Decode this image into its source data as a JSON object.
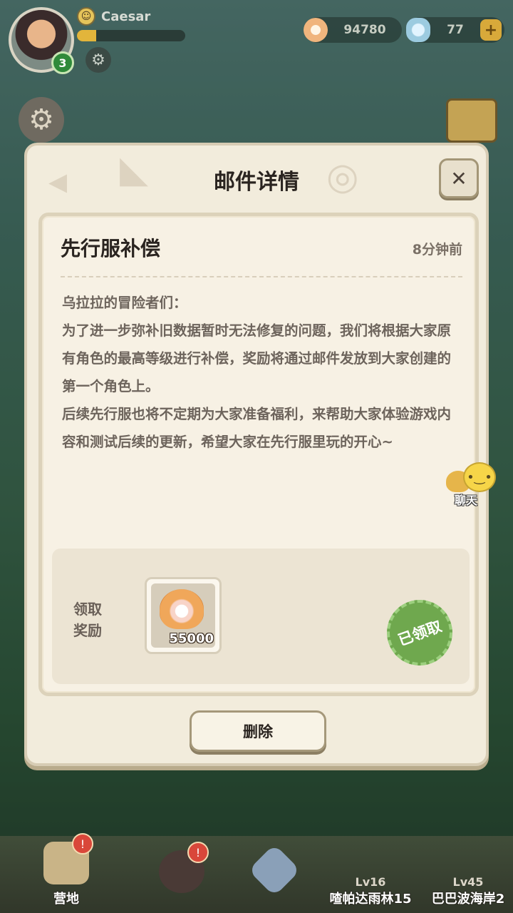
{
  "player": {
    "name": "Caesar",
    "level": "3",
    "xp_fraction": 0.18
  },
  "resources": {
    "coins": "94780",
    "gems": "77",
    "plus": "+"
  },
  "modal": {
    "title": "邮件详情",
    "close": "✕",
    "mail": {
      "subject": "先行服补偿",
      "time": "8分钟前",
      "body": [
        "乌拉拉的冒险者们：",
        "为了进一步弥补旧数据暂时无法修复的问题，我们将根据大家原有角色的最高等级进行补偿，奖励将通过邮件发放到大家创建的第一个角色上。",
        "后续先行服也将不定期为大家准备福利，来帮助大家体验游戏内容和测试后续的更新，希望大家在先行服里玩的开心~"
      ]
    },
    "reward": {
      "label_line1": "领取",
      "label_line2": "奖励",
      "item_icon": "pearl-shell-icon",
      "item_count": "55000",
      "status_stamp": "已领取"
    },
    "delete_label": "删除"
  },
  "chat": {
    "label": "聊天"
  },
  "bottom_nav": {
    "camp": {
      "label": "营地",
      "alert": "!"
    },
    "hero": {
      "alert": "!"
    },
    "weapon": {},
    "zone1": {
      "level": "Lv16",
      "name": "喳帕达雨林15"
    },
    "zone2": {
      "level": "Lv45",
      "name": "巴巴波海岸2"
    }
  },
  "colors": {
    "stamp_green": "#6fa84e",
    "modal_bg": "#f2ecdc",
    "coin_accent": "#f0b57d"
  }
}
